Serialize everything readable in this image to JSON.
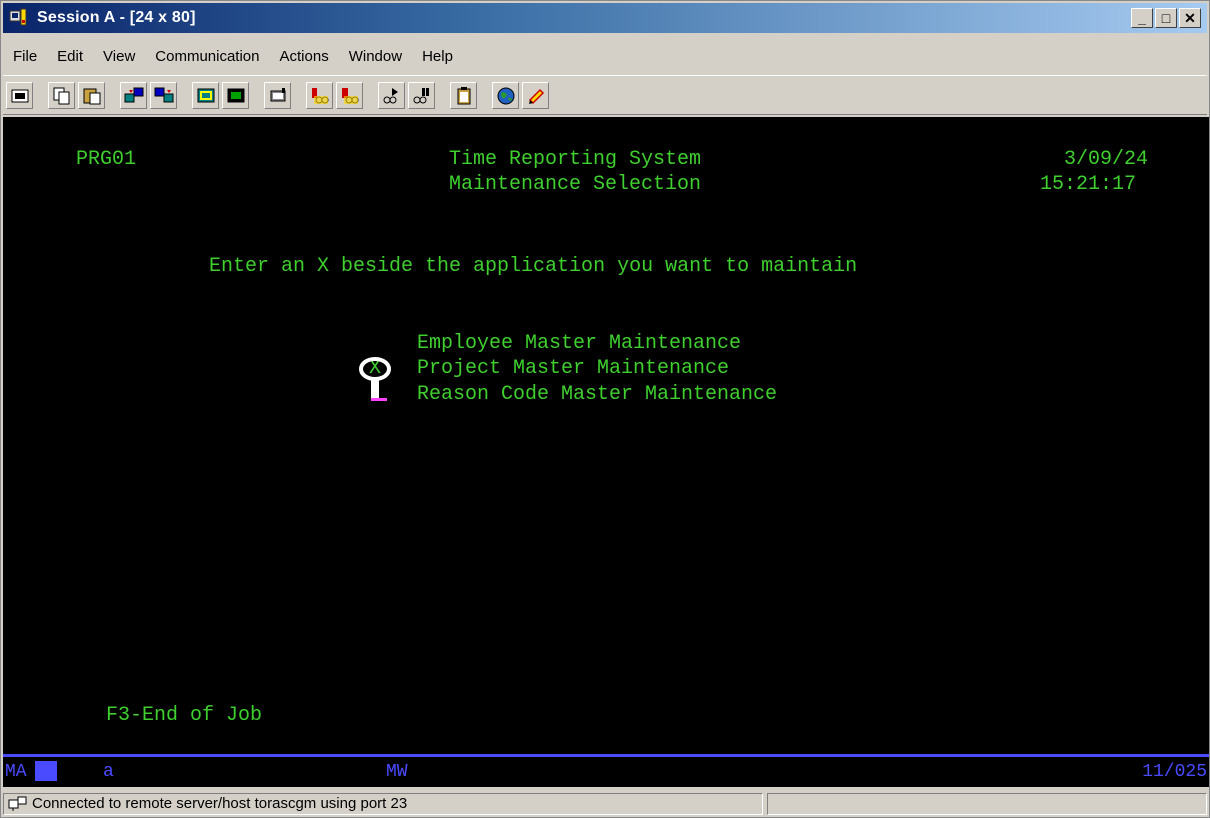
{
  "window": {
    "title": "Session A - [24 x 80]"
  },
  "menu": [
    {
      "label": "File"
    },
    {
      "label": "Edit"
    },
    {
      "label": "View"
    },
    {
      "label": "Communication"
    },
    {
      "label": "Actions"
    },
    {
      "label": "Window"
    },
    {
      "label": "Help"
    }
  ],
  "toolbar": {
    "icons": [
      "print-screen-icon",
      "copy-icon",
      "paste-icon",
      "send-file-icon",
      "receive-file-icon",
      "display-setup-icon",
      "keyboard-map-icon",
      "macro-icon",
      "record-macro-icon",
      "stop-macro-icon",
      "play-macro-icon",
      "pause-macro-icon",
      "clipboard-icon",
      "globe-icon",
      "help-icon"
    ]
  },
  "screen": {
    "program": "PRG01",
    "title1": "Time Reporting System",
    "title2": "Maintenance Selection",
    "date": "3/09/24",
    "time": "15:21:17",
    "instruction": "Enter an X beside the application you want to maintain",
    "options": [
      {
        "value": "",
        "label": "Employee Master Maintenance"
      },
      {
        "value": "X",
        "label": "Project Master Maintenance"
      },
      {
        "value": "",
        "label": "Reason Code Master Maintenance"
      }
    ],
    "fkeys": "F3-End of Job"
  },
  "oia": {
    "session": "MA",
    "input": "a",
    "mode": "MW",
    "cursor_pos": "11/025"
  },
  "statusbar": {
    "message": "Connected to remote server/host torascgm using port 23"
  },
  "colors": {
    "screen_fg": "#3fcf2f",
    "screen_bg": "#000000",
    "oia_line": "#4a4aff"
  }
}
